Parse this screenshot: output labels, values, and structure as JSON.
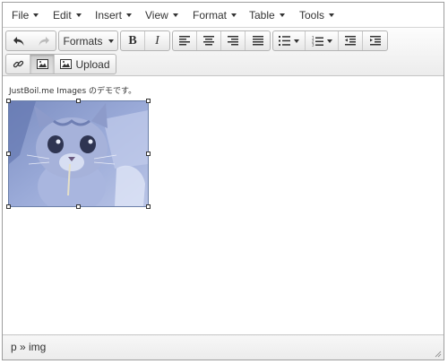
{
  "menubar": {
    "items": [
      {
        "label": "File"
      },
      {
        "label": "Edit"
      },
      {
        "label": "Insert"
      },
      {
        "label": "View"
      },
      {
        "label": "Format"
      },
      {
        "label": "Table"
      },
      {
        "label": "Tools"
      }
    ]
  },
  "toolbar": {
    "undo_icon": "undo-icon",
    "redo_icon": "redo-icon",
    "formats_label": "Formats",
    "bold_label": "B",
    "italic_label": "I",
    "upload_label": "Upload"
  },
  "content": {
    "paragraph": "JustBoil.me Images のデモです。",
    "image_selected": true
  },
  "statusbar": {
    "path": "p » img"
  },
  "colors": {
    "accent": "#8fa3d6",
    "border": "#9e9e9e",
    "text": "#333333"
  }
}
